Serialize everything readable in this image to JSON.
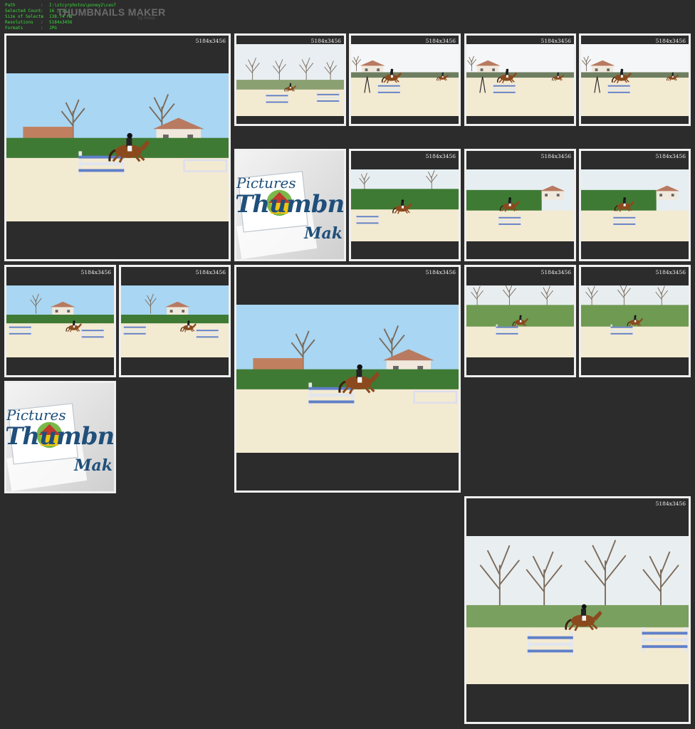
{
  "info": {
    "rows": [
      {
        "label": "Path",
        "value": "I:\\stcyrphotos\\poney2\\cav7"
      },
      {
        "label": "Selected Count",
        "value": "16 / 16"
      },
      {
        "label": "Size of Selecte",
        "value": "138.74 MB"
      },
      {
        "label": "Resolutions",
        "value": "5184x3456"
      },
      {
        "label": "Formats",
        "value": "JPG"
      }
    ],
    "separator": ":"
  },
  "app": {
    "title": "THUMBNAILS MAKER",
    "byline": "by Scorp"
  },
  "watermark": {
    "line1": "Pictures",
    "line2": "Thumbnails",
    "line3": "Mak"
  },
  "thumbnails": [
    {
      "resolution": "5184x3456",
      "scene": "jump-large"
    },
    {
      "resolution": "5184x3456",
      "scene": "arena-far"
    },
    {
      "resolution": "5184x3456",
      "scene": "fence-jump"
    },
    {
      "resolution": "5184x3456",
      "scene": "fence-jump"
    },
    {
      "resolution": "5184x3456",
      "scene": "fence-jump"
    },
    {
      "resolution": null,
      "scene": "watermark"
    },
    {
      "resolution": "5184x3456",
      "scene": "hedge-jump"
    },
    {
      "resolution": "5184x3456",
      "scene": "house-jump"
    },
    {
      "resolution": "5184x3456",
      "scene": "house-jump"
    },
    {
      "resolution": "5184x3456",
      "scene": "arena-side"
    },
    {
      "resolution": "5184x3456",
      "scene": "arena-side"
    },
    {
      "resolution": "5184x3456",
      "scene": "jump-large"
    },
    {
      "resolution": "5184x3456",
      "scene": "trees-jump"
    },
    {
      "resolution": "5184x3456",
      "scene": "trees-jump"
    },
    {
      "resolution": null,
      "scene": "watermark"
    },
    {
      "resolution": "5184x3456",
      "scene": "trees-wide"
    }
  ],
  "colors": {
    "background": "#2c2c2c",
    "tile_border": "#efefef",
    "info_text": "#3cdc3c",
    "sky": "#a9d6f2",
    "sand": "#f3ead2",
    "hedge": "#3f7a34",
    "horse": "#8a4a1e",
    "watermark_text": "#1f4f7a"
  }
}
